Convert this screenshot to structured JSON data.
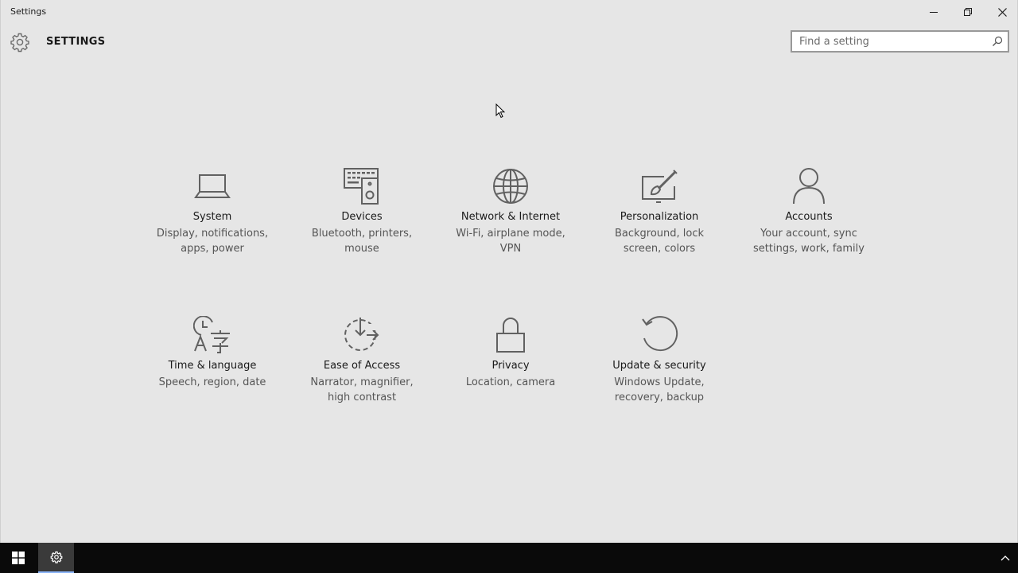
{
  "window": {
    "title": "Settings",
    "controls": [
      "minimize",
      "restore",
      "close"
    ]
  },
  "header": {
    "title": "SETTINGS",
    "icon": "gear-icon"
  },
  "search": {
    "placeholder": "Find a setting",
    "icon": "search-icon"
  },
  "categories": [
    {
      "name": "System",
      "desc": "Display, notifications, apps, power",
      "icon": "laptop-icon"
    },
    {
      "name": "Devices",
      "desc": "Bluetooth, printers, mouse",
      "icon": "devices-icon"
    },
    {
      "name": "Network & Internet",
      "desc": "Wi-Fi, airplane mode, VPN",
      "icon": "globe-icon"
    },
    {
      "name": "Personalization",
      "desc": "Background, lock screen, colors",
      "icon": "personalization-icon"
    },
    {
      "name": "Accounts",
      "desc": "Your account, sync settings, work, family",
      "icon": "person-icon"
    },
    {
      "name": "Time & language",
      "desc": "Speech, region, date",
      "icon": "time-language-icon"
    },
    {
      "name": "Ease of Access",
      "desc": "Narrator, magnifier, high contrast",
      "icon": "ease-of-access-icon"
    },
    {
      "name": "Privacy",
      "desc": "Location, camera",
      "icon": "lock-icon"
    },
    {
      "name": "Update & security",
      "desc": "Windows Update, recovery, backup",
      "icon": "update-icon"
    }
  ],
  "taskbar": {
    "start_icon": "windows-logo-icon",
    "apps": [
      {
        "icon": "gear-icon",
        "active": true
      }
    ],
    "tray_icon": "chevron-up-icon"
  },
  "colors": {
    "background": "#e6e6e6",
    "icon_stroke": "#616161",
    "text": "#1a1a1a",
    "subtext": "#555555",
    "taskbar": "#0a0a0a"
  }
}
